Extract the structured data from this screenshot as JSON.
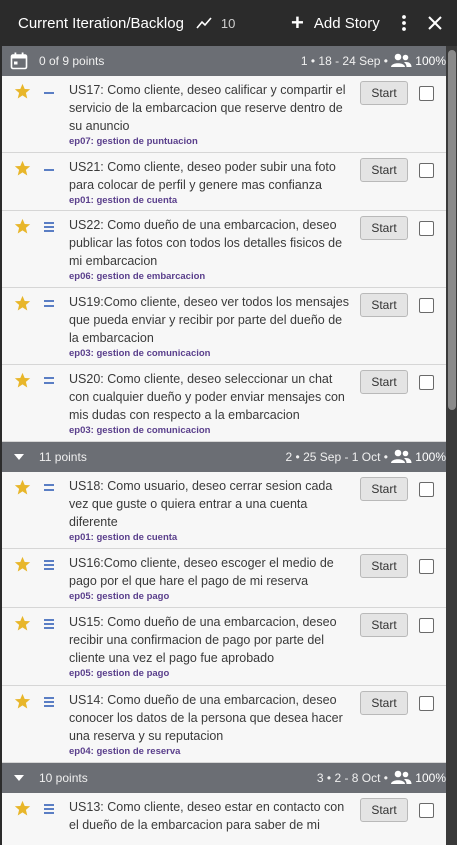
{
  "header": {
    "title": "Current Iteration/Backlog",
    "velocity": "10",
    "add_label": "Add Story"
  },
  "iterations": [
    {
      "points": "0 of 9 points",
      "meta": "1 • 18 - 24 Sep •",
      "team_pct": "100%",
      "icon": "calendar-icon"
    },
    {
      "points": "11 points",
      "meta": "2 • 25 Sep - 1 Oct •",
      "team_pct": "100%",
      "icon": "chevron-down-icon"
    },
    {
      "points": "10 points",
      "meta": "3 • 2 - 8 Oct •",
      "team_pct": "100%",
      "icon": "chevron-down-icon"
    }
  ],
  "stories": [
    {
      "text": "US17: Como cliente, deseo calificar y compartir el servicio de la embarcacion que reserve dentro de su anuncio",
      "epic": "ep07: gestion de puntuacion",
      "estimate": 1
    },
    {
      "text": "US21: Como cliente, deseo poder subir una foto para colocar de perfil y genere mas confianza",
      "epic": "ep01: gestion de cuenta",
      "estimate": 1
    },
    {
      "text": "US22: Como dueño de una embarcacion, deseo publicar las fotos con todos los detalles fisicos de mi embarcacion",
      "epic": "ep06: gestion de embarcacion",
      "estimate": 3
    },
    {
      "text": "US19:Como cliente, deseo ver todos los mensajes que pueda enviar y recibir por parte del dueño de la embarcacion",
      "epic": "ep03: gestion de comunicacion",
      "estimate": 2
    },
    {
      "text": "US20: Como cliente, deseo seleccionar un chat con cualquier dueño y poder enviar mensajes con mis dudas con respecto a la embarcacion",
      "epic": "ep03: gestion de comunicacion",
      "estimate": 2
    },
    {
      "text": "US18: Como usuario, deseo cerrar sesion cada vez que guste o quiera entrar a una cuenta diferente",
      "epic": "ep01: gestion de cuenta",
      "estimate": 2
    },
    {
      "text": "US16:Como cliente, deseo escoger el medio de pago por el que hare el pago de mi reserva",
      "epic": "ep05: gestion de pago",
      "estimate": 3
    },
    {
      "text": "US15: Como dueño de una embarcacion, deseo recibir una confirmacion de pago por parte del cliente una vez el pago fue aprobado",
      "epic": "ep05: gestion de pago",
      "estimate": 3
    },
    {
      "text": "US14: Como dueño de una embarcacion, deseo conocer los datos de la persona que desea hacer una reserva y su reputacion",
      "epic": "ep04: gestion de reserva",
      "estimate": 3
    },
    {
      "text": "US13: Como cliente, deseo estar en contacto con el dueño de la embarcacion para saber de mi",
      "epic": "",
      "estimate": 3
    }
  ],
  "start_label": "Start",
  "colors": {
    "topbar": "#2b2b2b",
    "iteration_header": "#6b6e74",
    "story_bg": "#f7f7f7",
    "star": "#e8b62a",
    "estimate": "#5a7ec4",
    "epic": "#5a3f8c"
  }
}
